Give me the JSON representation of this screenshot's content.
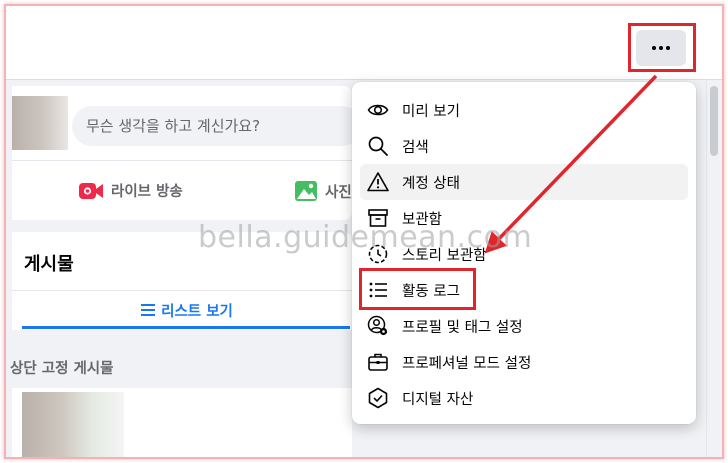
{
  "header": {
    "more_button_icon": "more-dots-icon"
  },
  "composer": {
    "placeholder": "무슨 생각을 하고 계신가요?",
    "live_label": "라이브 방송",
    "photo_label": "사진/"
  },
  "posts": {
    "title": "게시물",
    "list_view_label": "리스트 보기"
  },
  "pinned": {
    "label": "상단 고정 게시물"
  },
  "menu": {
    "items": [
      {
        "label": "미리 보기",
        "icon": "eye-icon"
      },
      {
        "label": "검색",
        "icon": "search-icon"
      },
      {
        "label": "계정 상태",
        "icon": "warning-icon"
      },
      {
        "label": "보관함",
        "icon": "archive-icon"
      },
      {
        "label": "스토리 보관함",
        "icon": "story-archive-icon"
      },
      {
        "label": "활동 로그",
        "icon": "activity-log-icon"
      },
      {
        "label": "프로필 및 태그 설정",
        "icon": "profile-settings-icon"
      },
      {
        "label": "프로페셔널 모드 설정",
        "icon": "professional-mode-icon"
      },
      {
        "label": "디지털 자산",
        "icon": "shield-check-icon"
      }
    ]
  },
  "watermark": "bella.guidemean.com",
  "colors": {
    "accent": "#1877f2",
    "annotation": "#e0262c",
    "live": "#f02849",
    "photo": "#45bd62"
  }
}
